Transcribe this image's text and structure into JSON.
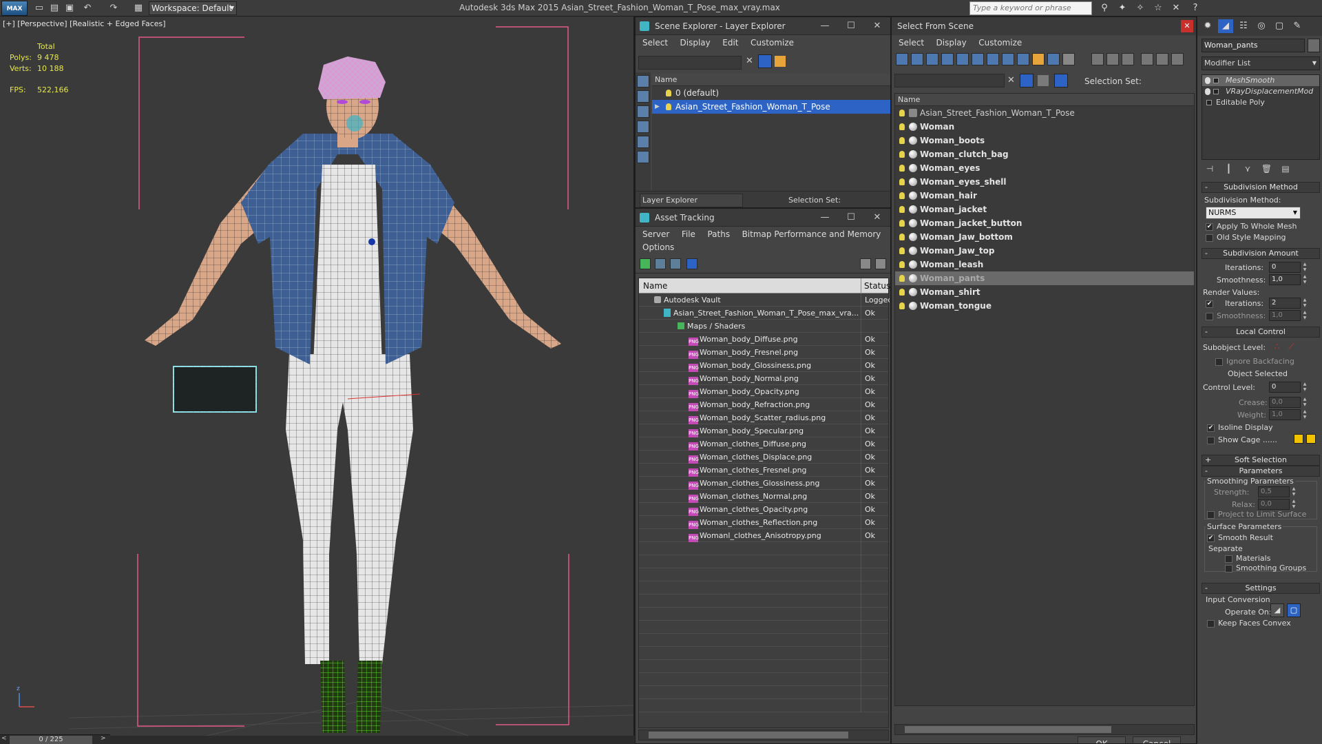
{
  "app": {
    "logo": "MAX",
    "title": "Autodesk 3ds Max  2015     Asian_Street_Fashion_Woman_T_Pose_max_vray.max",
    "workspace": "Workspace: Default",
    "search_placeholder": "Type a keyword or phrase"
  },
  "viewport": {
    "label": "[+] [Perspective] [Realistic + Edged Faces]",
    "stats": {
      "total": "Total",
      "polys_label": "Polys:",
      "polys": "9 478",
      "verts_label": "Verts:",
      "verts": "10 188"
    },
    "fps_label": "FPS:",
    "fps": "522,166"
  },
  "timeline": {
    "frame": "0 / 225"
  },
  "scene_explorer": {
    "title": "Scene Explorer - Layer Explorer",
    "menu": [
      "Select",
      "Display",
      "Edit",
      "Customize"
    ],
    "column": "Name",
    "rows": [
      "0 (default)",
      "Asian_Street_Fashion_Woman_T_Pose"
    ],
    "bottom_dropdown": "Layer Explorer",
    "selection_set": "Selection Set:"
  },
  "asset_tracking": {
    "title": "Asset Tracking",
    "menu": [
      "Server",
      "File",
      "Paths",
      "Bitmap Performance and Memory",
      "Options"
    ],
    "columns": {
      "name": "Name",
      "status": "Status"
    },
    "vault": {
      "name": "Autodesk Vault",
      "status": "Logged"
    },
    "file": {
      "name": "Asian_Street_Fashion_Woman_T_Pose_max_vra...",
      "status": "Ok"
    },
    "folder": {
      "name": "Maps / Shaders",
      "status": ""
    },
    "png_label": "PNG",
    "maps": [
      {
        "name": "Woman_body_Diffuse.png",
        "status": "Ok"
      },
      {
        "name": "Woman_body_Fresnel.png",
        "status": "Ok"
      },
      {
        "name": "Woman_body_Glossiness.png",
        "status": "Ok"
      },
      {
        "name": "Woman_body_Normal.png",
        "status": "Ok"
      },
      {
        "name": "Woman_body_Opacity.png",
        "status": "Ok"
      },
      {
        "name": "Woman_body_Refraction.png",
        "status": "Ok"
      },
      {
        "name": "Woman_body_Scatter_radius.png",
        "status": "Ok"
      },
      {
        "name": "Woman_body_Specular.png",
        "status": "Ok"
      },
      {
        "name": "Woman_clothes_Diffuse.png",
        "status": "Ok"
      },
      {
        "name": "Woman_clothes_Displace.png",
        "status": "Ok"
      },
      {
        "name": "Woman_clothes_Fresnel.png",
        "status": "Ok"
      },
      {
        "name": "Woman_clothes_Glossiness.png",
        "status": "Ok"
      },
      {
        "name": "Woman_clothes_Normal.png",
        "status": "Ok"
      },
      {
        "name": "Woman_clothes_Opacity.png",
        "status": "Ok"
      },
      {
        "name": "Woman_clothes_Reflection.png",
        "status": "Ok"
      },
      {
        "name": "Womanl_clothes_Anisotropy.png",
        "status": "Ok"
      }
    ]
  },
  "select_from_scene": {
    "title": "Select From Scene",
    "menu": [
      "Select",
      "Display",
      "Customize"
    ],
    "selection_set": "Selection Set:",
    "column": "Name",
    "parent": "Asian_Street_Fashion_Woman_T_Pose",
    "objects": [
      "Woman",
      "Woman_boots",
      "Woman_clutch_bag",
      "Woman_eyes",
      "Woman_eyes_shell",
      "Woman_hair",
      "Woman_jacket",
      "Woman_jacket_button",
      "Woman_Jaw_bottom",
      "Woman_Jaw_top",
      "Woman_leash",
      "Woman_pants",
      "Woman_shirt",
      "Woman_tongue"
    ],
    "highlighted": "Woman_pants",
    "ok": "OK",
    "cancel": "Cancel"
  },
  "command_panel": {
    "object_name": "Woman_pants",
    "modifier_list": "Modifier List",
    "stack": [
      "MeshSmooth",
      "VRayDisplacementMod",
      "Editable Poly"
    ],
    "subdivision_method": {
      "title": "Subdivision Method",
      "label": "Subdivision Method:",
      "value": "NURMS",
      "apply_whole_mesh": "Apply To Whole Mesh",
      "old_style": "Old Style Mapping"
    },
    "subdivision_amount": {
      "title": "Subdivision Amount",
      "iterations_label": "Iterations:",
      "iterations": "0",
      "smoothness_label": "Smoothness:",
      "smoothness": "1,0",
      "render_values": "Render Values:",
      "render_iterations": "2",
      "render_smoothness": "1,0"
    },
    "local_control": {
      "title": "Local Control",
      "subobject_level": "Subobject Level:",
      "ignore_backfacing": "Ignore Backfacing",
      "object_selected": "Object Selected",
      "control_level_label": "Control Level:",
      "control_level": "0",
      "crease_label": "Crease:",
      "crease": "0,0",
      "weight_label": "Weight:",
      "weight": "1,0",
      "isoline": "Isoline Display",
      "show_cage": "Show Cage ......"
    },
    "soft_selection": "Soft Selection",
    "parameters": {
      "title": "Parameters",
      "smoothing": "Smoothing Parameters",
      "strength_label": "Strength:",
      "strength": "0,5",
      "relax_label": "Relax:",
      "relax": "0,0",
      "project": "Project to Limit Surface",
      "surface": "Surface Parameters",
      "smooth_result": "Smooth Result",
      "separate": "Separate",
      "materials": "Materials",
      "smoothing_groups": "Smoothing Groups"
    },
    "settings": {
      "title": "Settings",
      "input_conversion": "Input Conversion",
      "operate_on": "Operate On:",
      "keep_faces": "Keep Faces Convex"
    }
  },
  "colors": {
    "accent": "#2c63c4",
    "bulb": "#e7d24b",
    "stats": "#e8e84a",
    "close": "#c9302c"
  }
}
